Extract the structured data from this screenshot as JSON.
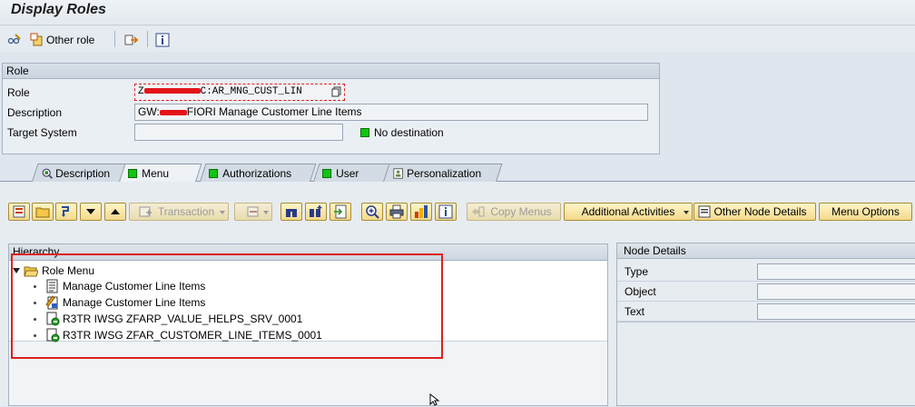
{
  "window": {
    "title": "Display Roles"
  },
  "app_toolbar": {
    "other_role_label": "Other role"
  },
  "role_box": {
    "header": "Role",
    "role_label": "Role",
    "role_value_prefix": "Z",
    "role_value_suffix": "C:AR_MNG_CUST_LIN",
    "description_label": "Description",
    "description_prefix": "GW:",
    "description_suffix": "FIORI Manage Customer Line Items",
    "target_system_label": "Target System",
    "target_system_value": "",
    "destination_status": "No destination"
  },
  "tabs": [
    {
      "label": "Description",
      "active": false
    },
    {
      "label": "Menu",
      "active": true
    },
    {
      "label": "Authorizations",
      "active": false
    },
    {
      "label": "User",
      "active": false
    },
    {
      "label": "Personalization",
      "active": false
    }
  ],
  "menu_toolbar": {
    "transaction_label": "Transaction",
    "copy_menus_label": "Copy Menus",
    "additional_activities_label": "Additional Activities",
    "other_node_details_label": "Other Node Details",
    "menu_options_label": "Menu Options"
  },
  "hierarchy": {
    "header": "Hierarchy",
    "root": "Role Menu",
    "items": [
      {
        "label": "Manage Customer Line Items",
        "icon": "document-icon"
      },
      {
        "label": "Manage Customer Line Items",
        "icon": "fiori-app-icon"
      },
      {
        "label": "R3TR IWSG ZFARP_VALUE_HELPS_SRV_0001",
        "icon": "service-icon"
      },
      {
        "label": "R3TR IWSG ZFAR_CUSTOMER_LINE_ITEMS_0001",
        "icon": "service-icon"
      }
    ]
  },
  "node_details": {
    "header": "Node Details",
    "type_label": "Type",
    "object_label": "Object",
    "text_label": "Text"
  },
  "colors": {
    "accent_green": "#12c412",
    "highlight_red": "#e02020",
    "redaction_red": "#e3141b"
  }
}
